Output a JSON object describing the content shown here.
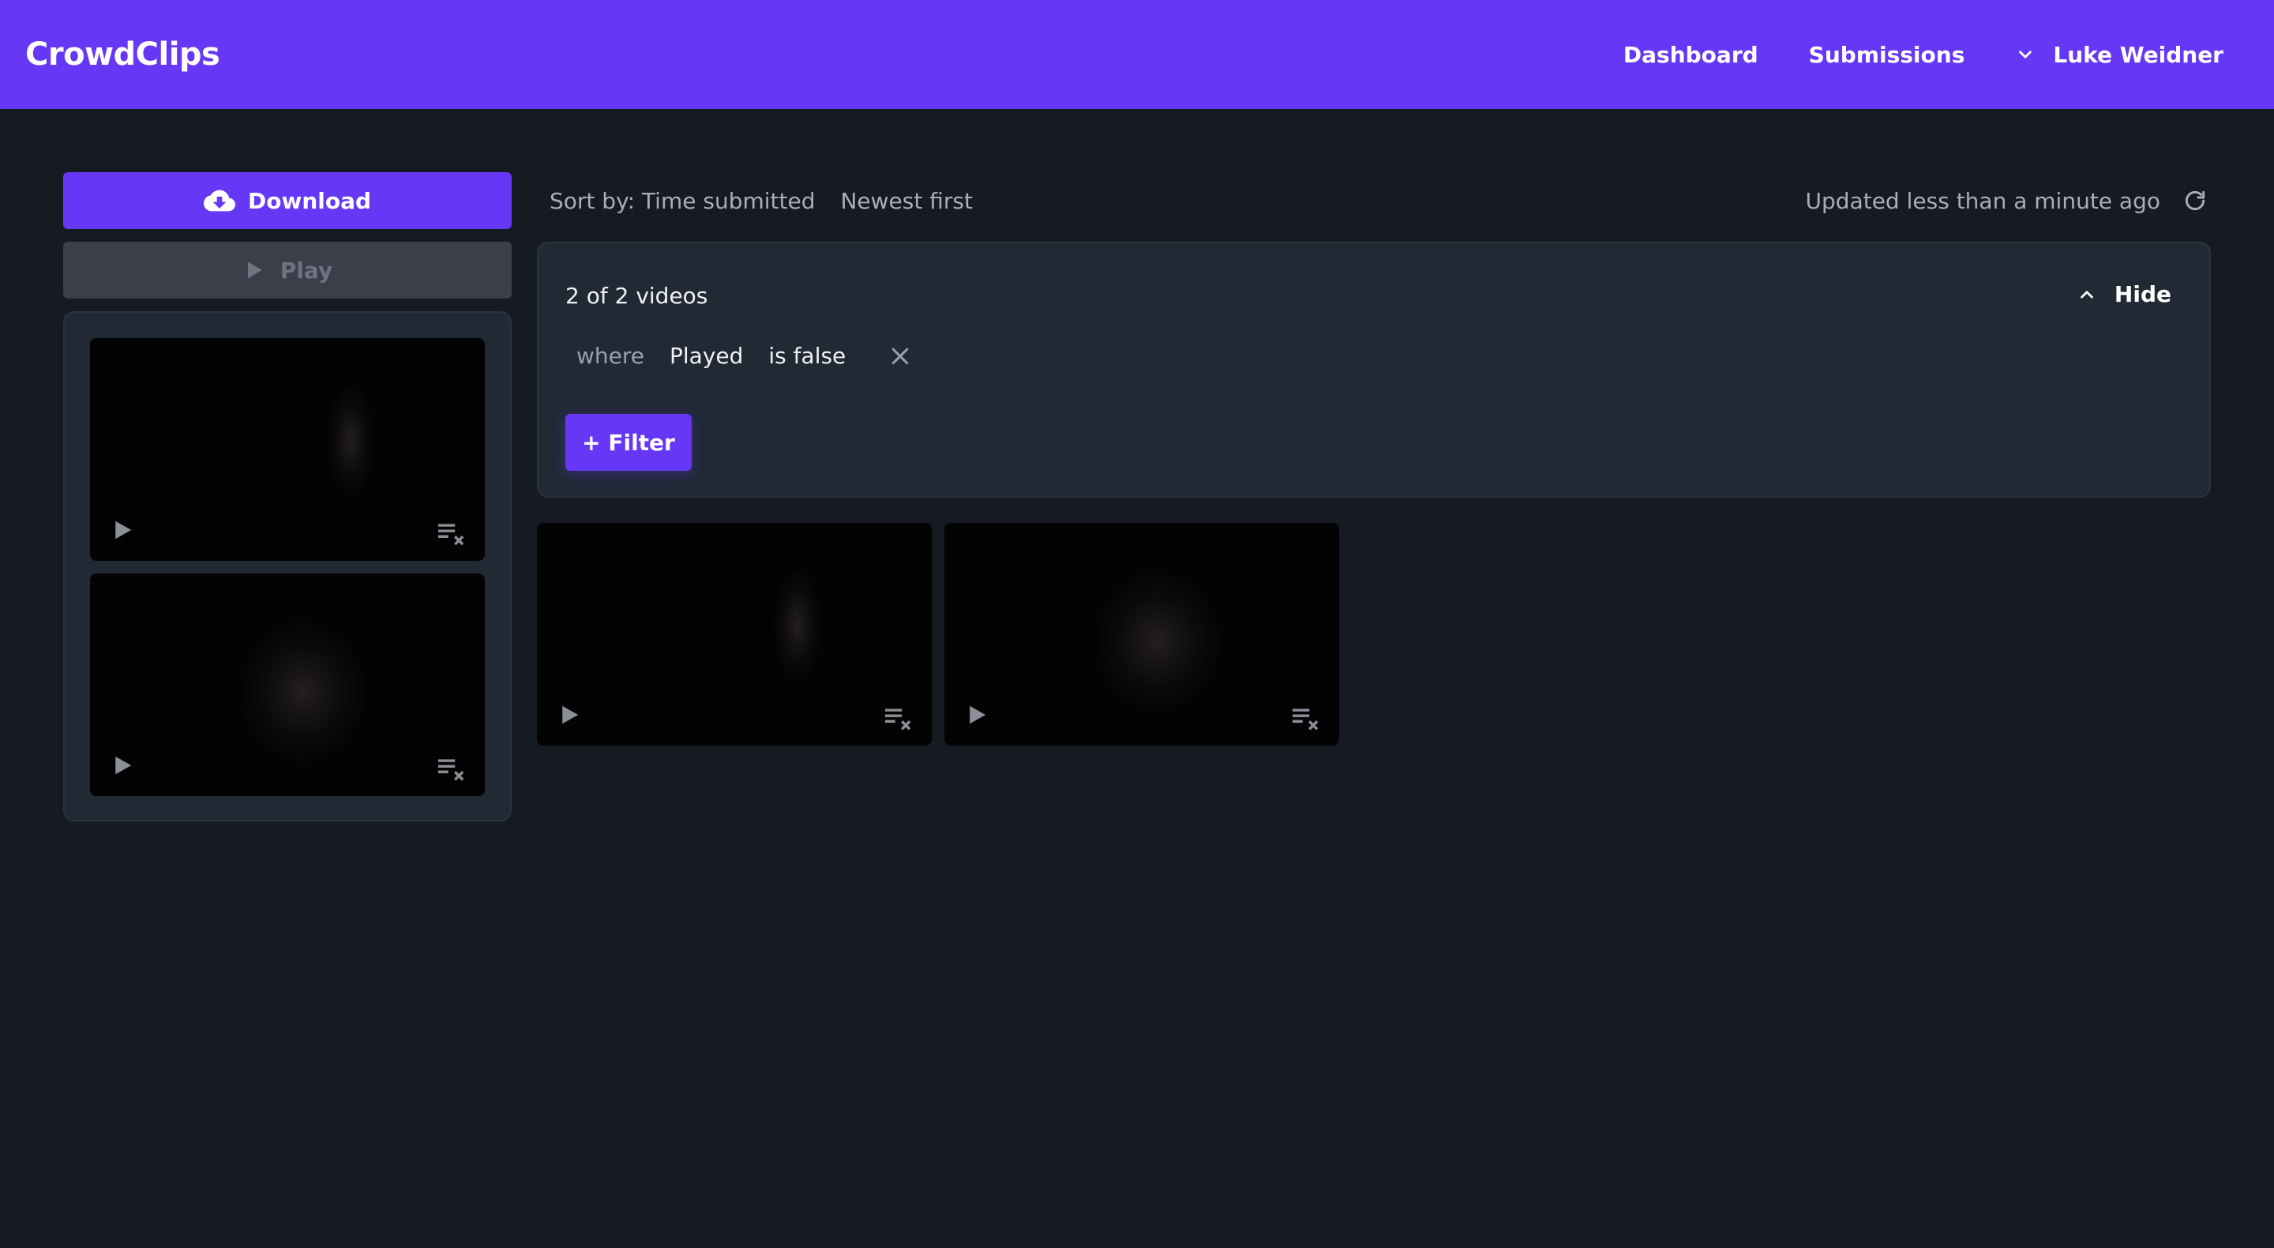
{
  "header": {
    "brand": "CrowdClips",
    "nav": {
      "dashboard": "Dashboard",
      "submissions": "Submissions"
    },
    "user_name": "Luke Weidner",
    "accent_color": "#6638f5"
  },
  "sidebar": {
    "download_label": "Download",
    "play_label": "Play"
  },
  "toolbar": {
    "sort_by": "Sort by: Time submitted",
    "sort_order": "Newest first",
    "updated": "Updated less than a minute ago"
  },
  "filters": {
    "count_text": "2 of 2 videos",
    "hide_label": "Hide",
    "rule": {
      "where": "where",
      "field": "Played",
      "condition": "is false"
    },
    "add_filter_label": "+ Filter"
  },
  "icons": {
    "download": "cloud-download-icon",
    "play": "play-icon",
    "remove_from_queue": "playlist-remove-icon",
    "refresh": "refresh-icon",
    "chevron_up": "chevron-up-icon",
    "chevron_down": "chevron-down-icon",
    "close": "close-icon"
  }
}
